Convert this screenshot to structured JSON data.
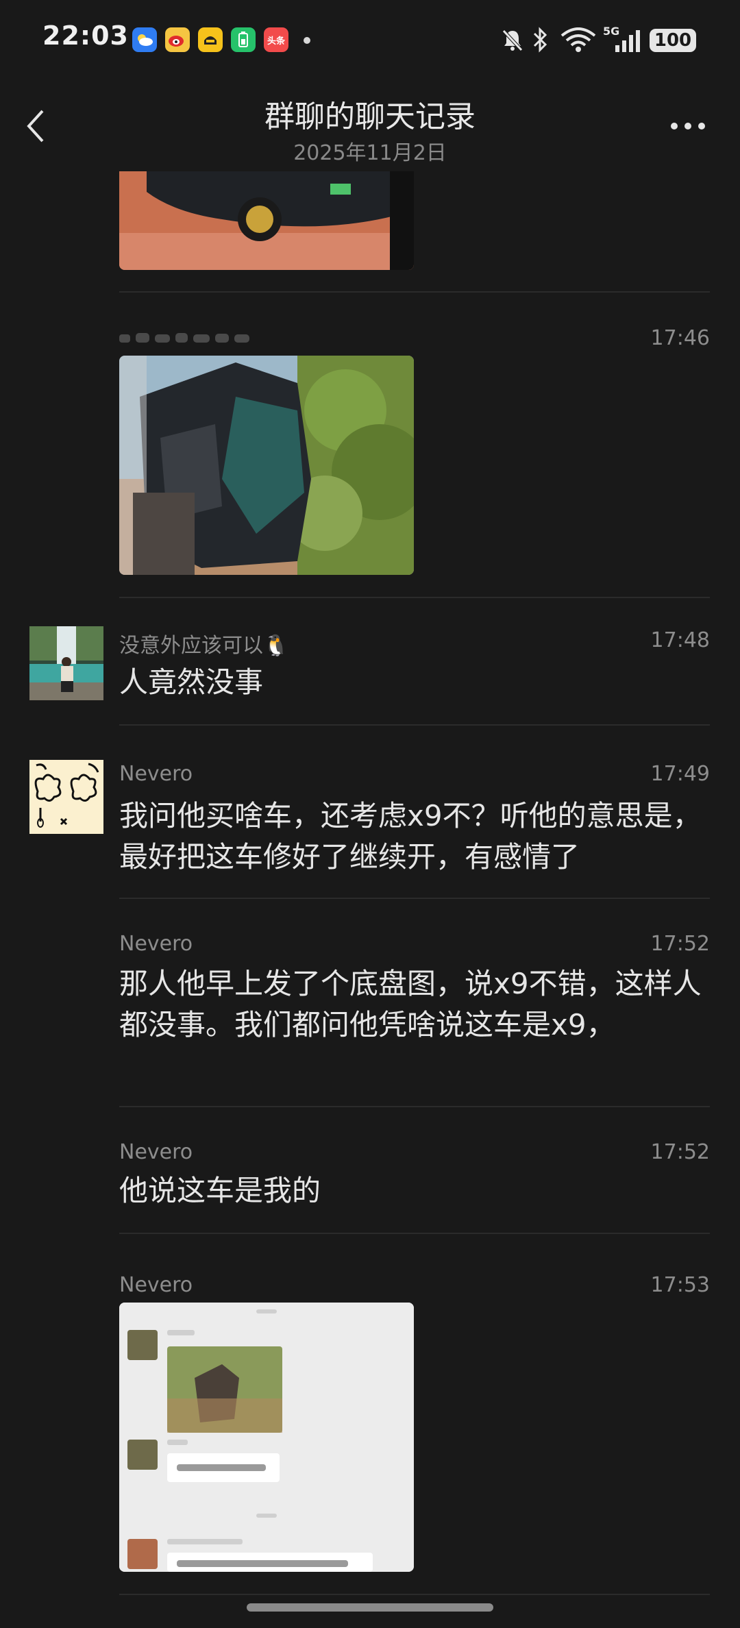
{
  "status_bar": {
    "time": "22:03",
    "app_icons": [
      "weather-icon",
      "weibo-icon",
      "fun-app-icon",
      "battery-app-icon",
      "toutiao-icon"
    ],
    "toutiao_label": "头条",
    "battery": "100",
    "network": "5G"
  },
  "header": {
    "title": "群聊的聊天记录",
    "subtitle": "2025年11月2日",
    "back_icon": "chevron-left-icon",
    "more_icon": "more-icon"
  },
  "messages": [
    {
      "sender": "",
      "time": "",
      "type": "image",
      "subject": "crashed-car-partial"
    },
    {
      "sender": "",
      "time": "17:46",
      "type": "image",
      "subject": "crashed-car-in-bushes"
    },
    {
      "sender": "没意外应该可以🐧",
      "time": "17:48",
      "type": "text",
      "text": "人竟然没事"
    },
    {
      "sender": "Nevero",
      "time": "17:49",
      "type": "text",
      "text": "我问他买啥车，还考虑x9不？听他的意思是，最好把这车修好了继续开，有感情了"
    },
    {
      "sender": "Nevero",
      "time": "17:52",
      "type": "text",
      "text": "那人他早上发了个底盘图，说x9不错，这样人都没事。我们都问他凭啥说这车是x9，"
    },
    {
      "sender": "Nevero",
      "time": "17:52",
      "type": "text",
      "text": "他说这车是我的"
    },
    {
      "sender": "Nevero",
      "time": "17:53",
      "type": "image",
      "subject": "chat-screenshot-blurred"
    }
  ],
  "colors": {
    "background": "#191919",
    "text": "#e6e6e6",
    "meta": "#8d8d8d",
    "divider": "#2b2b2b"
  }
}
